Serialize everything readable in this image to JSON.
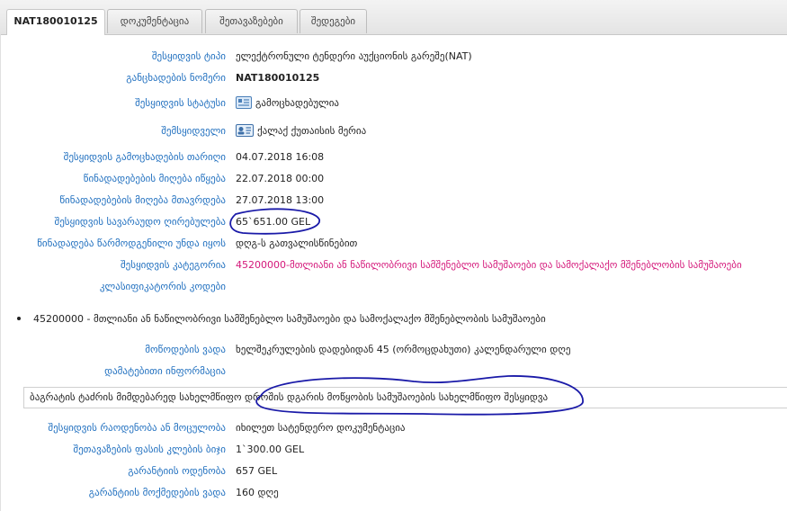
{
  "tabs": [
    {
      "label": "NAT180010125",
      "active": true
    },
    {
      "label": "დოკუმენტაცია",
      "active": false
    },
    {
      "label": "შეთავაზებები",
      "active": false
    },
    {
      "label": "შედეგები",
      "active": false
    }
  ],
  "fields": {
    "purchase_type": {
      "label": "შესყიდვის ტიპი",
      "value": "ელექტრონული ტენდერი აუქციონის გარეშე(NAT)"
    },
    "notice_number": {
      "label": "განცხადების ნომერი",
      "value": "NAT180010125"
    },
    "purchase_status": {
      "label": "შესყიდვის სტატუსი",
      "value": "გამოცხადებულია"
    },
    "buyer": {
      "label": "შემსყიდველი",
      "value": "ქალაქ ქუთაისის მერია"
    },
    "announce_date": {
      "label": "შესყიდვის გამოცხადების თარიღი",
      "value": "04.07.2018 16:08"
    },
    "bids_start": {
      "label": "წინადადებების მიღება იწყება",
      "value": "22.07.2018 00:00"
    },
    "bids_end": {
      "label": "წინადადებების მიღება მთავრდება",
      "value": "27.07.2018 13:00"
    },
    "estimated_value": {
      "label": "შესყიდვის სავარაუდო ღირებულება",
      "value": "65`651.00 GEL"
    },
    "bid_including": {
      "label": "წინადადება წარმოდგენილი უნდა იყოს",
      "value": "დღგ-ს გათვალისწინებით"
    },
    "category": {
      "label": "შესყიდვის კატეგორია",
      "value": "45200000-მთლიანი ან ნაწილობრივი სამშენებლო სამუშაოები და სამოქალაქო მშენებლობის სამუშაოები"
    },
    "classifier_codes": {
      "label": "კლასიფიკატორის კოდები",
      "value": ""
    },
    "delivery_term": {
      "label": "მოწოდების ვადა",
      "value": "ხელშეკრულების დადებიდან 45 (ორმოცდახუთი) კალენდარული დღე"
    },
    "additional_info": {
      "label": "დამატებითი ინფორმაცია",
      "value": ""
    },
    "quantity": {
      "label": "შესყიდვის რაოდენობა ან მოცულობა",
      "value": "იხილეთ სატენდერო დოკუმენტაცია"
    },
    "price_step": {
      "label": "შეთავაზების ფასის კლების ბიჯი",
      "value": "1`300.00 GEL"
    },
    "guarantee_amount": {
      "label": "გარანტიის ოდენობა",
      "value": "657 GEL"
    },
    "guarantee_term": {
      "label": "გარანტიის მოქმედების ვადა",
      "value": "160 დღე"
    }
  },
  "classifier_item": "45200000 - მთლიანი ან ნაწილობრივი სამშენებლო სამუშაოები და სამოქალაქო მშენებლობის სამუშაოები",
  "description": "ბაგრატის ტაძრის მიმდებარედ სახელმწიფო დროშის დგარის მოწყობის სამუშაოების სახელმწიფო შესყიდვა",
  "colors": {
    "label": "#1f6fbf",
    "category": "#d4177a",
    "annotation": "#1a1aa8"
  },
  "icons": {
    "status": "document-list-icon",
    "buyer": "id-card-icon"
  }
}
